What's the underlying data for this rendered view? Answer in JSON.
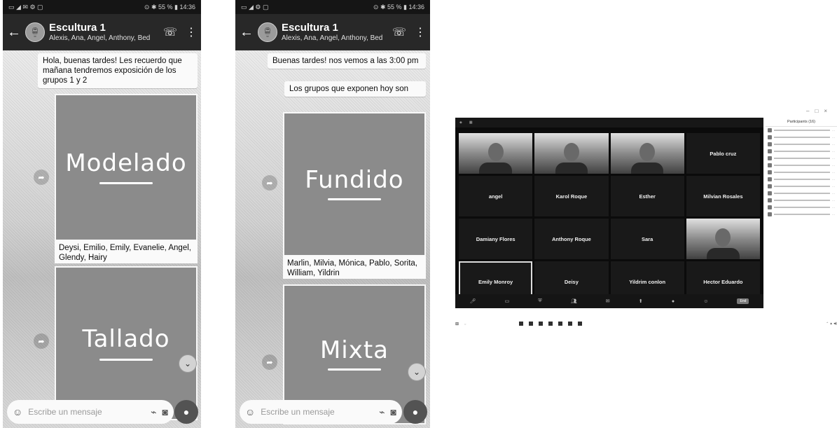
{
  "phone1": {
    "status_right": "⊙ ✱ 55 % ▮ 14:36",
    "chat": {
      "title": "Escultura 1",
      "members": "Alexis, Ana, Angel, Anthony, Bed",
      "avatar": "🏺"
    },
    "messages": [
      {
        "text": "Hola, buenas tardes! Les recuerdo que mañana tendremos exposición de los grupos 1 y 2"
      }
    ],
    "images": [
      {
        "word": "Modelado",
        "caption": "Deysi, Emilio, Emily, Evanelie, Angel, Glendy, Hairy"
      },
      {
        "word": "Tallado"
      }
    ],
    "input_placeholder": "Escribe un mensaje"
  },
  "phone2": {
    "status_right": "⊙ ✱ 55 % ▮ 14:36",
    "chat": {
      "title": "Escultura 1",
      "members": "Alexis, Ana, Angel, Anthony, Bed",
      "avatar": "🏺"
    },
    "messages": [
      {
        "text": "Buenas tardes! nos vemos a las 3:00 pm"
      },
      {
        "text": "Los grupos que exponen hoy son"
      }
    ],
    "images": [
      {
        "word": "Fundido",
        "caption": "Marlin, Milvia, Mónica, Pablo, Sorita, William, Yildrin"
      },
      {
        "word": "Mixta"
      }
    ],
    "input_placeholder": "Escribe un mensaje"
  },
  "zoom": {
    "panel_title": "Participants (16)",
    "participants": [
      {
        "name": "",
        "video": true
      },
      {
        "name": "",
        "video": true
      },
      {
        "name": "",
        "video": true
      },
      {
        "name": "Pablo cruz",
        "video": false
      },
      {
        "name": "angel",
        "video": false
      },
      {
        "name": "Karol Roque",
        "video": false
      },
      {
        "name": "Esther",
        "video": false
      },
      {
        "name": "Milvian Rosales",
        "video": false
      },
      {
        "name": "Damiany Flores",
        "video": false
      },
      {
        "name": "Anthony Roque",
        "video": false
      },
      {
        "name": "Sara",
        "video": false
      },
      {
        "name": "",
        "video": true
      },
      {
        "name": "Emily Monroy",
        "video": false,
        "active": true
      },
      {
        "name": "Deisy",
        "video": false
      },
      {
        "name": "Yildrim conlon",
        "video": false
      },
      {
        "name": "Hector Eduardo",
        "video": false
      }
    ],
    "panel_row_count": 13,
    "end_label": "End"
  },
  "colors": {
    "bubble": "#f4f4f4",
    "appbar": "#2c2c2c",
    "zoom_bg": "#111111"
  }
}
